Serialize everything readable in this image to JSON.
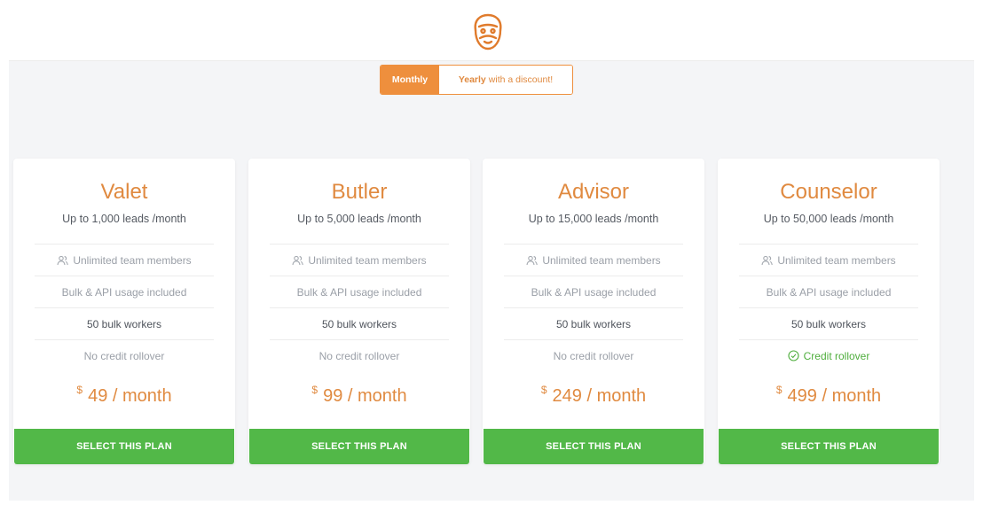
{
  "colors": {
    "accent": "#ee8f3d",
    "plan_name": "#e08a40",
    "button_green": "#52b848",
    "rollover_green": "#4fae3d",
    "background": "#f4f5f7"
  },
  "header": {
    "logo_icon": "bearded-face-icon"
  },
  "billing_toggle": {
    "monthly_label": "Monthly",
    "yearly_label": "Yearly",
    "yearly_suffix": "with a discount!",
    "selected": "Monthly"
  },
  "plans": [
    {
      "name": "Valet",
      "leads": "Up to 1,000 leads /month",
      "team": "Unlimited team members",
      "team_icon": "users-icon",
      "usage": "Bulk & API usage included",
      "workers": "50 bulk workers",
      "rollover": "No credit rollover",
      "currency": "$",
      "price": "49 / month",
      "button": "SELECT THIS PLAN"
    },
    {
      "name": "Butler",
      "leads": "Up to 5,000 leads /month",
      "team": "Unlimited team members",
      "team_icon": "users-icon",
      "usage": "Bulk & API usage included",
      "workers": "50 bulk workers",
      "rollover": "No credit rollover",
      "currency": "$",
      "price": "99 / month",
      "button": "SELECT THIS PLAN"
    },
    {
      "name": "Advisor",
      "leads": "Up to 15,000 leads /month",
      "team": "Unlimited team members",
      "team_icon": "users-icon",
      "usage": "Bulk & API usage included",
      "workers": "50 bulk workers",
      "rollover": "No credit rollover",
      "currency": "$",
      "price": "249 / month",
      "button": "SELECT THIS PLAN"
    },
    {
      "name": "Counselor",
      "leads": "Up to 50,000 leads /month",
      "team": "Unlimited team members",
      "team_icon": "users-icon",
      "usage": "Bulk & API usage included",
      "workers": "50 bulk workers",
      "rollover": "Credit rollover",
      "rollover_icon": "check-circle-icon",
      "currency": "$",
      "price": "499 / month",
      "button": "SELECT THIS PLAN"
    }
  ]
}
